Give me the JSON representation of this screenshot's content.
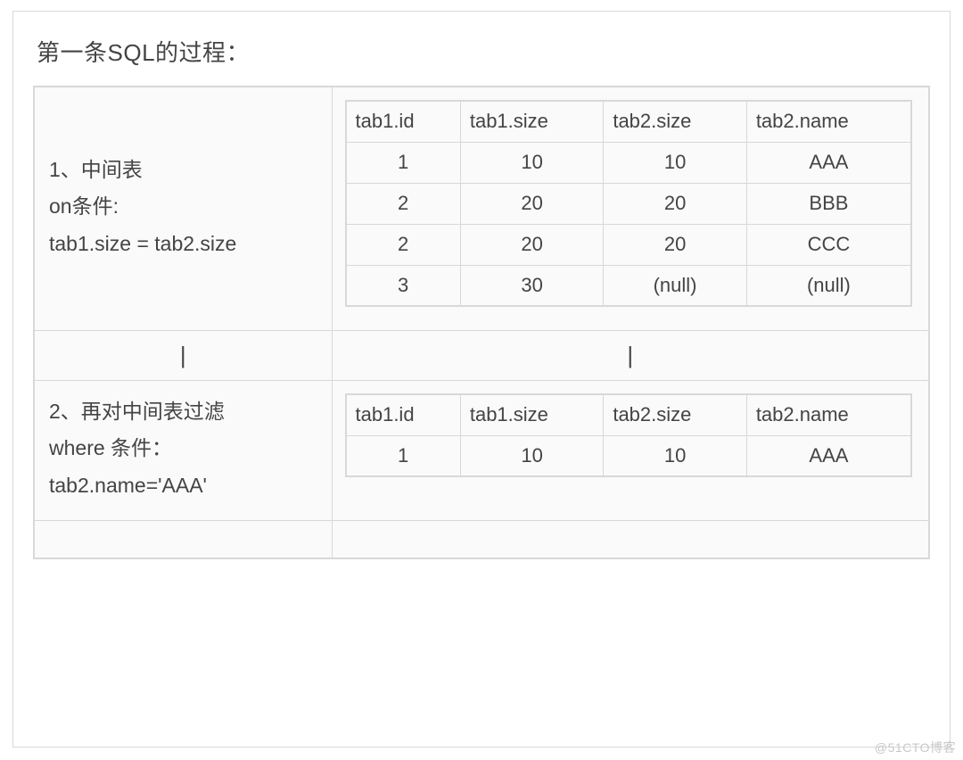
{
  "title": "第一条SQL的过程：",
  "step1": {
    "desc_line1": "1、中间表",
    "desc_line2": "on条件:",
    "desc_line3": "tab1.size = tab2.size",
    "headers": [
      "tab1.id",
      "tab1.size",
      "tab2.size",
      "tab2.name"
    ],
    "rows": [
      [
        "1",
        "10",
        "10",
        "AAA"
      ],
      [
        "2",
        "20",
        "20",
        "BBB"
      ],
      [
        "2",
        "20",
        "20",
        "CCC"
      ],
      [
        "3",
        "30",
        "(null)",
        "(null)"
      ]
    ]
  },
  "arrow": {
    "left": "|",
    "right": "|"
  },
  "step2": {
    "desc_line1": "2、再对中间表过滤",
    "desc_line2": "where 条件：",
    "desc_line3": "tab2.name='AAA'",
    "headers": [
      "tab1.id",
      "tab1.size",
      "tab2.size",
      "tab2.name"
    ],
    "rows": [
      [
        "1",
        "10",
        "10",
        "AAA"
      ]
    ]
  },
  "watermark": "@51CTO博客"
}
